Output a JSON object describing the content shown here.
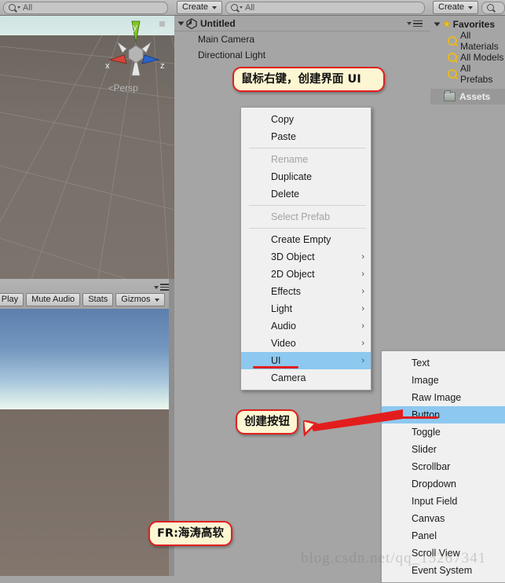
{
  "scene_view": {
    "search_placeholder": "All",
    "gizmo": {
      "x_label": "x",
      "y_label": "y",
      "z_label": "z",
      "projection": "Persp"
    }
  },
  "game_view": {
    "toolbar_buttons": [
      "On Play",
      "Mute Audio",
      "Stats",
      "Gizmos"
    ]
  },
  "hierarchy": {
    "create_label": "Create",
    "search_placeholder": "All",
    "scene_name": "Untitled",
    "objects": [
      {
        "label": "Main Camera"
      },
      {
        "label": "Directional Light"
      }
    ]
  },
  "project": {
    "create_label": "Create",
    "favorites_label": "Favorites",
    "favorites": [
      {
        "label": "All Materials"
      },
      {
        "label": "All Models"
      },
      {
        "label": "All Prefabs"
      }
    ],
    "assets_label": "Assets"
  },
  "context_menu": {
    "items": [
      {
        "label": "Copy",
        "state": "normal",
        "submenu": false
      },
      {
        "label": "Paste",
        "state": "normal",
        "submenu": false
      },
      {
        "label": "_sep1",
        "state": "separator",
        "submenu": false
      },
      {
        "label": "Rename",
        "state": "disabled",
        "submenu": false
      },
      {
        "label": "Duplicate",
        "state": "normal",
        "submenu": false
      },
      {
        "label": "Delete",
        "state": "normal",
        "submenu": false
      },
      {
        "label": "_sep2",
        "state": "separator",
        "submenu": false
      },
      {
        "label": "Select Prefab",
        "state": "disabled",
        "submenu": false
      },
      {
        "label": "_sep3",
        "state": "separator",
        "submenu": false
      },
      {
        "label": "Create Empty",
        "state": "normal",
        "submenu": false
      },
      {
        "label": "3D Object",
        "state": "normal",
        "submenu": true
      },
      {
        "label": "2D Object",
        "state": "normal",
        "submenu": true
      },
      {
        "label": "Effects",
        "state": "normal",
        "submenu": true
      },
      {
        "label": "Light",
        "state": "normal",
        "submenu": true
      },
      {
        "label": "Audio",
        "state": "normal",
        "submenu": true
      },
      {
        "label": "Video",
        "state": "normal",
        "submenu": true
      },
      {
        "label": "UI",
        "state": "selected",
        "submenu": true
      },
      {
        "label": "Camera",
        "state": "normal",
        "submenu": false
      }
    ]
  },
  "ui_submenu": {
    "items": [
      {
        "label": "Text",
        "state": "normal"
      },
      {
        "label": "Image",
        "state": "normal"
      },
      {
        "label": "Raw Image",
        "state": "normal"
      },
      {
        "label": "Button",
        "state": "selected"
      },
      {
        "label": "Toggle",
        "state": "normal"
      },
      {
        "label": "Slider",
        "state": "normal"
      },
      {
        "label": "Scrollbar",
        "state": "normal"
      },
      {
        "label": "Dropdown",
        "state": "normal"
      },
      {
        "label": "Input Field",
        "state": "normal"
      },
      {
        "label": "Canvas",
        "state": "normal"
      },
      {
        "label": "Panel",
        "state": "normal"
      },
      {
        "label": "Scroll View",
        "state": "normal"
      },
      {
        "label": "Event System",
        "state": "normal"
      }
    ]
  },
  "annotations": [
    {
      "text": "鼠标右键，创建界面 UI"
    },
    {
      "text": "创建按钮"
    },
    {
      "text": "FR:海涛高软"
    }
  ],
  "watermark": "blog.csdn.net/qq_15267341",
  "colors": {
    "highlight": "#8dc8f0",
    "annotation_border": "#e02020",
    "annotation_fill": "#fdf6d2",
    "panel_bg": "#a5a5a5",
    "menu_bg": "#f0f0f0"
  }
}
